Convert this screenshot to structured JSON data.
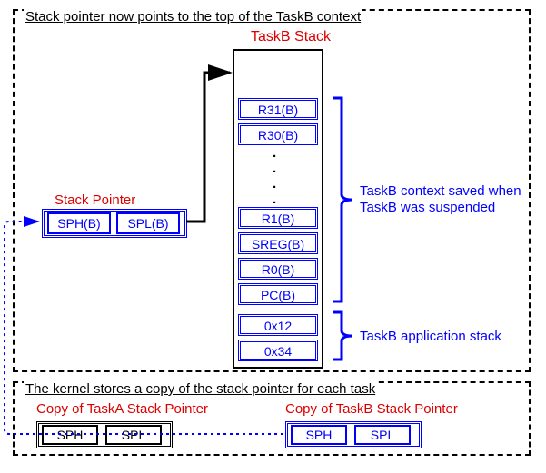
{
  "top": {
    "title": "Stack pointer now points to the top of the TaskB context",
    "stack_label": "TaskB Stack",
    "cells": [
      "R31(B)",
      "R30(B)",
      "R1(B)",
      "SREG(B)",
      "R0(B)",
      "PC(B)",
      "0x12",
      "0x34"
    ],
    "stack_pointer_label": "Stack Pointer",
    "sph": "SPH(B)",
    "spl": "SPL(B)",
    "annot_context_line1": "TaskB context saved when",
    "annot_context_line2": "TaskB was suspended",
    "annot_app": "TaskB application stack"
  },
  "bottom": {
    "title": "The kernel stores a copy of the stack pointer for each task",
    "copyA_label": "Copy of TaskA Stack Pointer",
    "copyB_label": "Copy of TaskB Stack Pointer",
    "a_sph": "SPH",
    "a_spl": "SPL",
    "b_sph": "SPH",
    "b_spl": "SPL"
  }
}
